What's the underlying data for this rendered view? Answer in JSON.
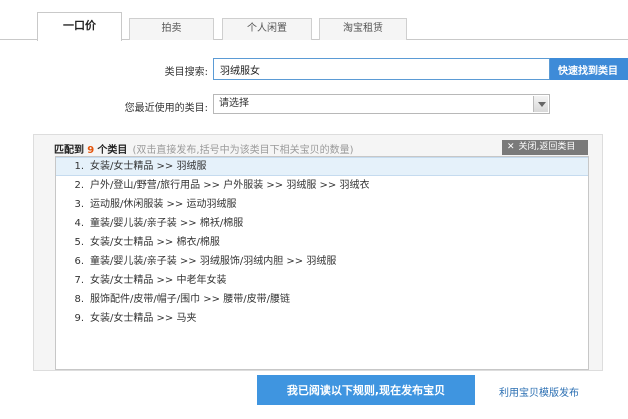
{
  "tabs": [
    {
      "label": "一口价"
    },
    {
      "label": "拍卖"
    },
    {
      "label": "个人闲置"
    },
    {
      "label": "淘宝租赁"
    }
  ],
  "search": {
    "label": "类目搜索:",
    "value": "羽绒服女",
    "button": "快速找到类目"
  },
  "recent": {
    "label": "您最近使用的类目:",
    "selected": "请选择"
  },
  "match": {
    "prefix": "匹配到",
    "count": "9",
    "suffix": "个类目",
    "hint": "(双击直接发布,括号中为该类目下相关宝贝的数量)",
    "close_x": "✕",
    "close_label": "关闭,返回类目"
  },
  "results": [
    {
      "num": "1.",
      "path": "女装/女士精品 >> 羽绒服"
    },
    {
      "num": "2.",
      "path": "户外/登山/野营/旅行用品 >> 户外服装 >> 羽绒服 >> 羽绒衣"
    },
    {
      "num": "3.",
      "path": "运动服/休闲服装 >> 运动羽绒服"
    },
    {
      "num": "4.",
      "path": "童装/婴儿装/亲子装 >> 棉袄/棉服"
    },
    {
      "num": "5.",
      "path": "女装/女士精品 >> 棉衣/棉服"
    },
    {
      "num": "6.",
      "path": "童装/婴儿装/亲子装 >> 羽绒服饰/羽绒内胆 >> 羽绒服"
    },
    {
      "num": "7.",
      "path": "女装/女士精品 >> 中老年女装"
    },
    {
      "num": "8.",
      "path": "服饰配件/皮带/帽子/围巾 >> 腰带/皮带/腰链"
    },
    {
      "num": "9.",
      "path": "女装/女士精品 >> 马夹"
    }
  ],
  "footer": {
    "publish": "我已阅读以下规则,现在发布宝贝",
    "template": "利用宝贝模版发布"
  },
  "colors": {
    "accent": "#3e8bd8",
    "count": "#e4540b",
    "selected_row": "#e5f1fa"
  }
}
